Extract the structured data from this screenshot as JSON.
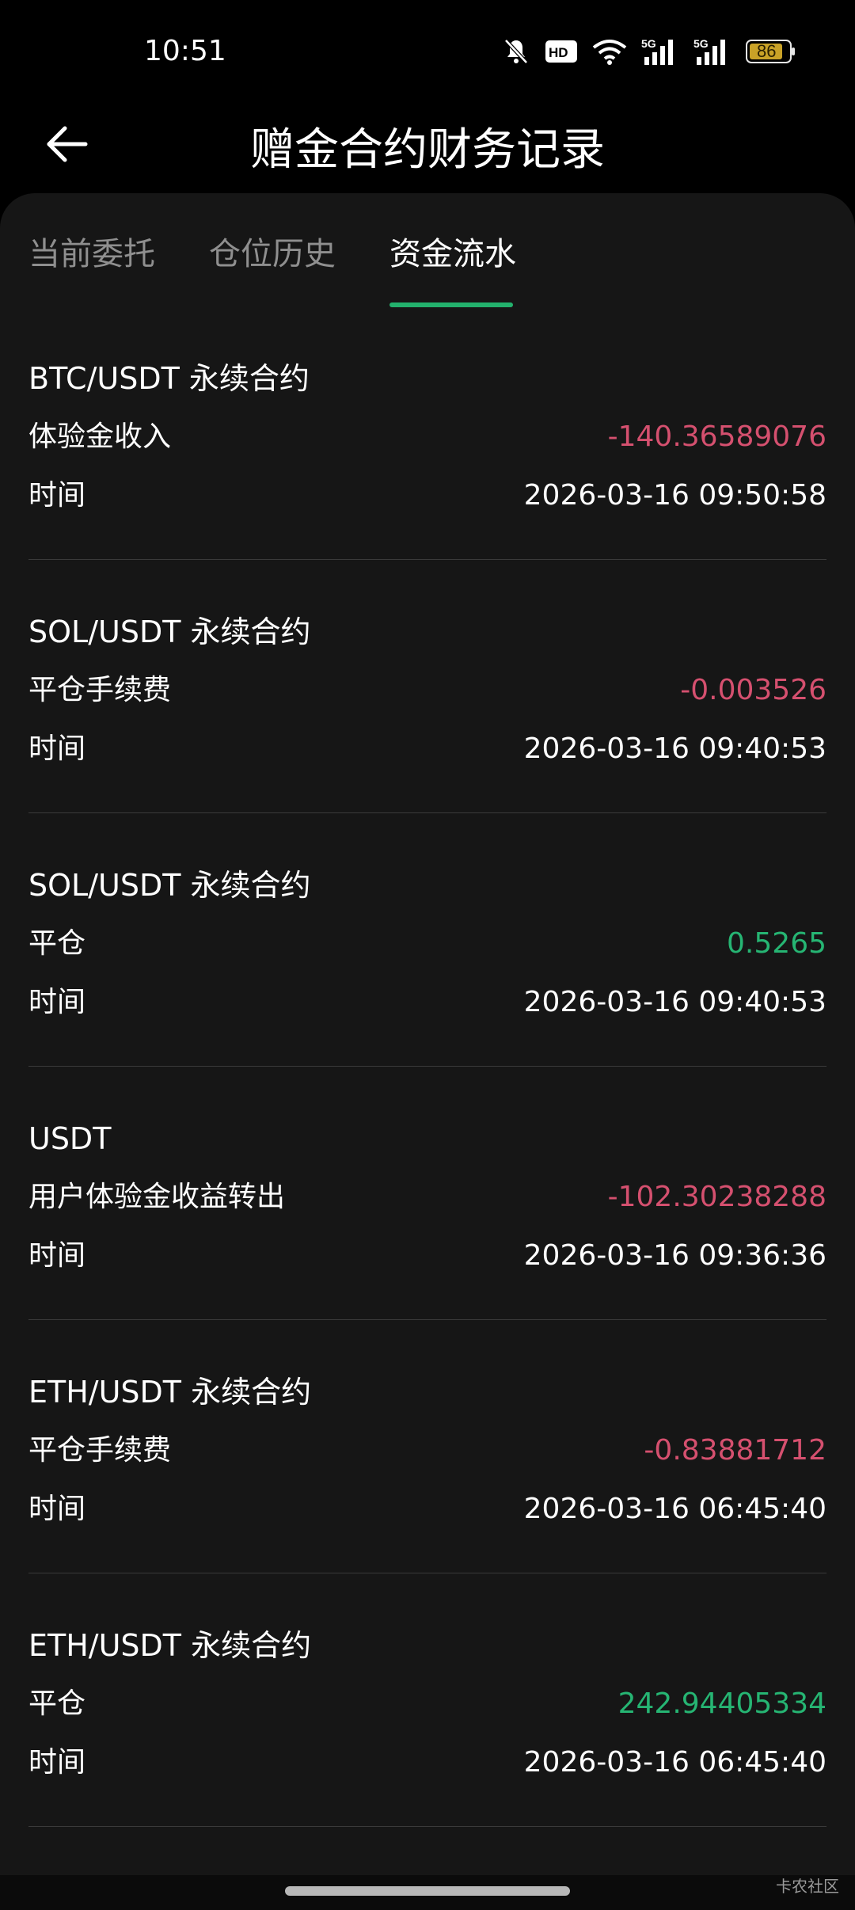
{
  "status_bar": {
    "time": "10:51",
    "network_a": "5G",
    "network_b": "5G",
    "battery": "86",
    "icons": [
      "mute-icon",
      "hd-voice-icon",
      "wifi-icon",
      "signal-icon",
      "signal-icon",
      "battery-icon"
    ]
  },
  "header": {
    "title": "赠金合约财务记录",
    "back_icon": "back-arrow-icon"
  },
  "tabs": [
    {
      "label": "当前委托",
      "active": false
    },
    {
      "label": "仓位历史",
      "active": false
    },
    {
      "label": "资金流水",
      "active": true
    }
  ],
  "colors": {
    "accent": "#23b26d",
    "negative": "#d5506f",
    "positive": "#26b573",
    "panel_bg": "#161616"
  },
  "records": [
    {
      "pair": "BTC/USDT 永续合约",
      "type": "体验金收入",
      "amount": "-140.36589076",
      "sign": "neg",
      "time_label": "时间",
      "time": "2026-03-16 09:50:58"
    },
    {
      "pair": "SOL/USDT 永续合约",
      "type": "平仓手续费",
      "amount": "-0.003526",
      "sign": "neg",
      "time_label": "时间",
      "time": "2026-03-16 09:40:53"
    },
    {
      "pair": "SOL/USDT 永续合约",
      "type": "平仓",
      "amount": "0.5265",
      "sign": "pos",
      "time_label": "时间",
      "time": "2026-03-16 09:40:53"
    },
    {
      "pair": "USDT",
      "type": "用户体验金收益转出",
      "amount": "-102.30238288",
      "sign": "neg",
      "time_label": "时间",
      "time": "2026-03-16 09:36:36"
    },
    {
      "pair": "ETH/USDT 永续合约",
      "type": "平仓手续费",
      "amount": "-0.83881712",
      "sign": "neg",
      "time_label": "时间",
      "time": "2026-03-16 06:45:40"
    },
    {
      "pair": "ETH/USDT 永续合约",
      "type": "平仓",
      "amount": "242.94405334",
      "sign": "pos",
      "time_label": "时间",
      "time": "2026-03-16 06:45:40"
    }
  ],
  "watermark": "卡农社区"
}
